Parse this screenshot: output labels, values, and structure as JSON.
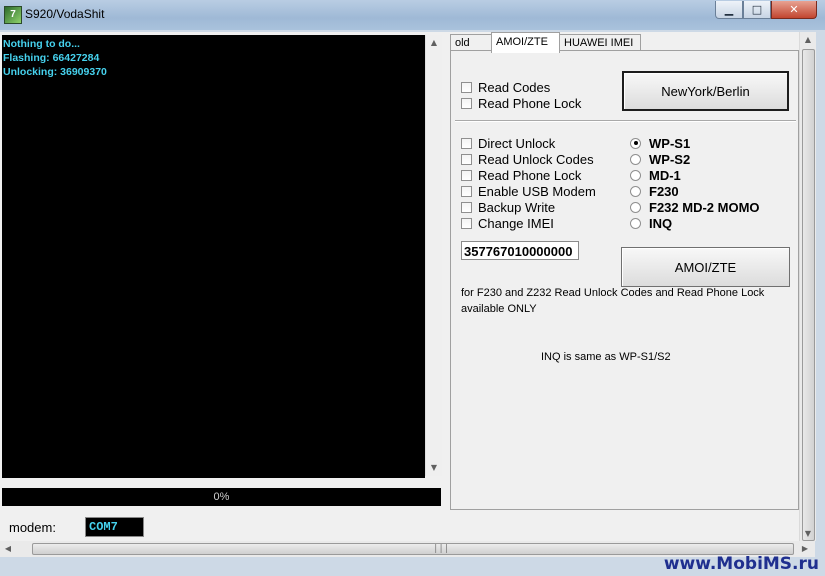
{
  "window": {
    "title": "S920/VodaShit",
    "icon": "app-icon",
    "controls": {
      "minimize": "▁",
      "maximize": "□",
      "close": "✕"
    }
  },
  "log": {
    "lines": [
      "Nothing to do...",
      "Flashing: 66427284",
      "Unlocking: 36909370"
    ]
  },
  "progress": {
    "label": "0%",
    "value": 0
  },
  "modem": {
    "label": "modem:",
    "value": "COM7"
  },
  "tabs": [
    {
      "label": "old",
      "active": false
    },
    {
      "label": "AMOI/ZTE",
      "active": true
    },
    {
      "label": "HUAWEI IMEI",
      "active": false
    }
  ],
  "top_checks": [
    {
      "label": "Read Codes",
      "checked": false
    },
    {
      "label": "Read Phone Lock",
      "checked": false
    }
  ],
  "newyork_button": "NewYork/Berlin",
  "options": [
    {
      "label": "Direct Unlock",
      "checked": false
    },
    {
      "label": "Read Unlock Codes",
      "checked": false
    },
    {
      "label": "Read Phone Lock",
      "checked": false
    },
    {
      "label": "Enable USB Modem",
      "checked": false
    },
    {
      "label": "Backup Write",
      "checked": false
    },
    {
      "label": "Change IMEI",
      "checked": false
    }
  ],
  "models": [
    {
      "label": "WP-S1",
      "selected": true
    },
    {
      "label": "WP-S2",
      "selected": false
    },
    {
      "label": "MD-1",
      "selected": false
    },
    {
      "label": "F230",
      "selected": false
    },
    {
      "label": "F232 MD-2 MOMO",
      "selected": false
    },
    {
      "label": "INQ",
      "selected": false
    }
  ],
  "imei_value": "357767010000000",
  "amoi_button": "AMOI/ZTE",
  "note_lines": [
    "for F230 and Z232 Read Unlock Codes and Read Phone Lock",
    "available ONLY"
  ],
  "inq_note": "INQ is same as WP-S1/S2",
  "watermark": "www.MobiMS.ru",
  "colors": {
    "log_text": "#46d2ee",
    "log_bg": "#000000"
  }
}
